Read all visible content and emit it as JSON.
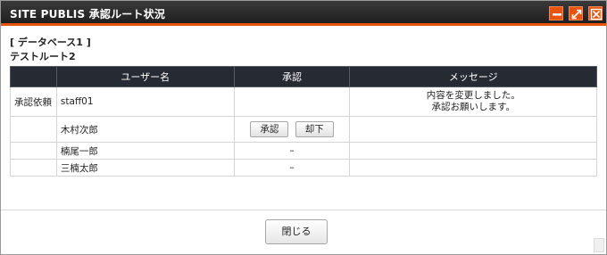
{
  "window": {
    "title": "SITE PUBLIS 承認ルート状況"
  },
  "content": {
    "database_label": "[ データベース1 ]",
    "route_name": "テストルート2"
  },
  "table": {
    "headers": [
      "",
      "ユーザー名",
      "承認",
      "メッセージ"
    ],
    "rows": [
      {
        "status": "承認依頼",
        "user": "staff01",
        "approval": "",
        "message_line1": "内容を変更しました。",
        "message_line2": "承認お願いします。"
      },
      {
        "status": "",
        "user": "木村次郎",
        "approve_label": "承認",
        "reject_label": "却下",
        "message": ""
      },
      {
        "status": "",
        "user": "楠尾一郎",
        "approval": "–",
        "message": ""
      },
      {
        "status": "",
        "user": "三楠太郎",
        "approval": "–",
        "message": ""
      }
    ]
  },
  "footer": {
    "close_label": "閉じる"
  },
  "colors": {
    "titlebar": "#262626",
    "accent": "#e8540e",
    "header": "#262a33"
  },
  "icons": {
    "minimize": "minimize-icon",
    "maximize": "maximize-icon",
    "close": "close-icon"
  }
}
